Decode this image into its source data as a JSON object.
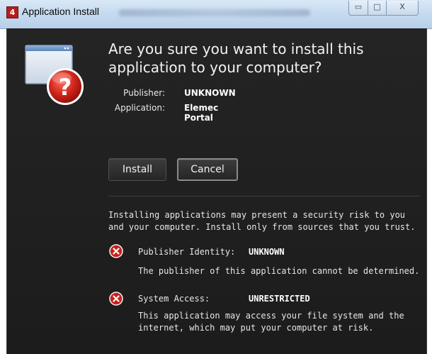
{
  "window": {
    "title": "Application Install",
    "logo_glyph": "4",
    "min_glyph": "▭",
    "max_glyph": "□",
    "close_glyph": "X"
  },
  "dialog": {
    "heading": "Are you sure you want to install this application to your computer?",
    "publisher_label": "Publisher:",
    "publisher_value": "UNKNOWN",
    "application_label": "Application:",
    "application_value": "Elemec Portal",
    "install_label": "Install",
    "cancel_label": "Cancel",
    "warning": "Installing applications may present a security risk to you and your computer. Install only from sources that you trust.",
    "publisher_identity_label": "Publisher Identity:",
    "publisher_identity_value": "UNKNOWN",
    "publisher_identity_desc": "The publisher of this application cannot be determined.",
    "system_access_label": "System Access:",
    "system_access_value": "UNRESTRICTED",
    "system_access_desc": "This application may access your file system and the internet, which may put your computer at risk."
  },
  "colors": {
    "content_bg": "#1f1f1f",
    "titlebar": "#c6dbf0",
    "warning_red": "#c8211b",
    "text": "#e6e6e6"
  },
  "icons": {
    "hero": "window-question-icon",
    "publisher_identity": "error-x-icon",
    "system_access": "error-x-icon"
  }
}
